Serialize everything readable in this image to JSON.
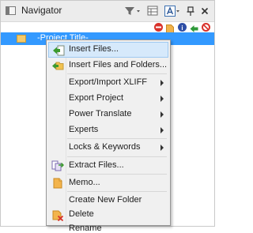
{
  "navigator": {
    "title": "Navigator",
    "icons": {
      "filter": "filter-icon",
      "grid": "grid-icon",
      "font": "font-icon",
      "pin": "pin-icon",
      "close": "close-icon"
    }
  },
  "tree": {
    "selected_label": "-Project Title-",
    "selection_color": "#3399ff"
  },
  "status_icons": [
    "no-entry-icon",
    "document-icon",
    "info-icon",
    "arrow-left-icon",
    "blocked-icon"
  ],
  "context_menu": {
    "items": [
      {
        "label": "Insert Files...",
        "icon": "insert-files-icon",
        "highlighted": true
      },
      {
        "label": "Insert Files and Folders...",
        "icon": "insert-folders-icon"
      },
      {
        "label": "Export/Import XLIFF",
        "submenu": true
      },
      {
        "label": "Export Project",
        "submenu": true
      },
      {
        "label": "Power Translate",
        "submenu": true
      },
      {
        "label": "Experts",
        "submenu": true
      },
      {
        "label": "Locks & Keywords",
        "submenu": true
      },
      {
        "label": "Extract Files...",
        "icon": "extract-files-icon"
      },
      {
        "label": "Memo...",
        "icon": "memo-icon"
      },
      {
        "label": "Create New Folder"
      },
      {
        "label": "Delete",
        "icon": "delete-icon"
      },
      {
        "label": "Rename"
      }
    ]
  }
}
